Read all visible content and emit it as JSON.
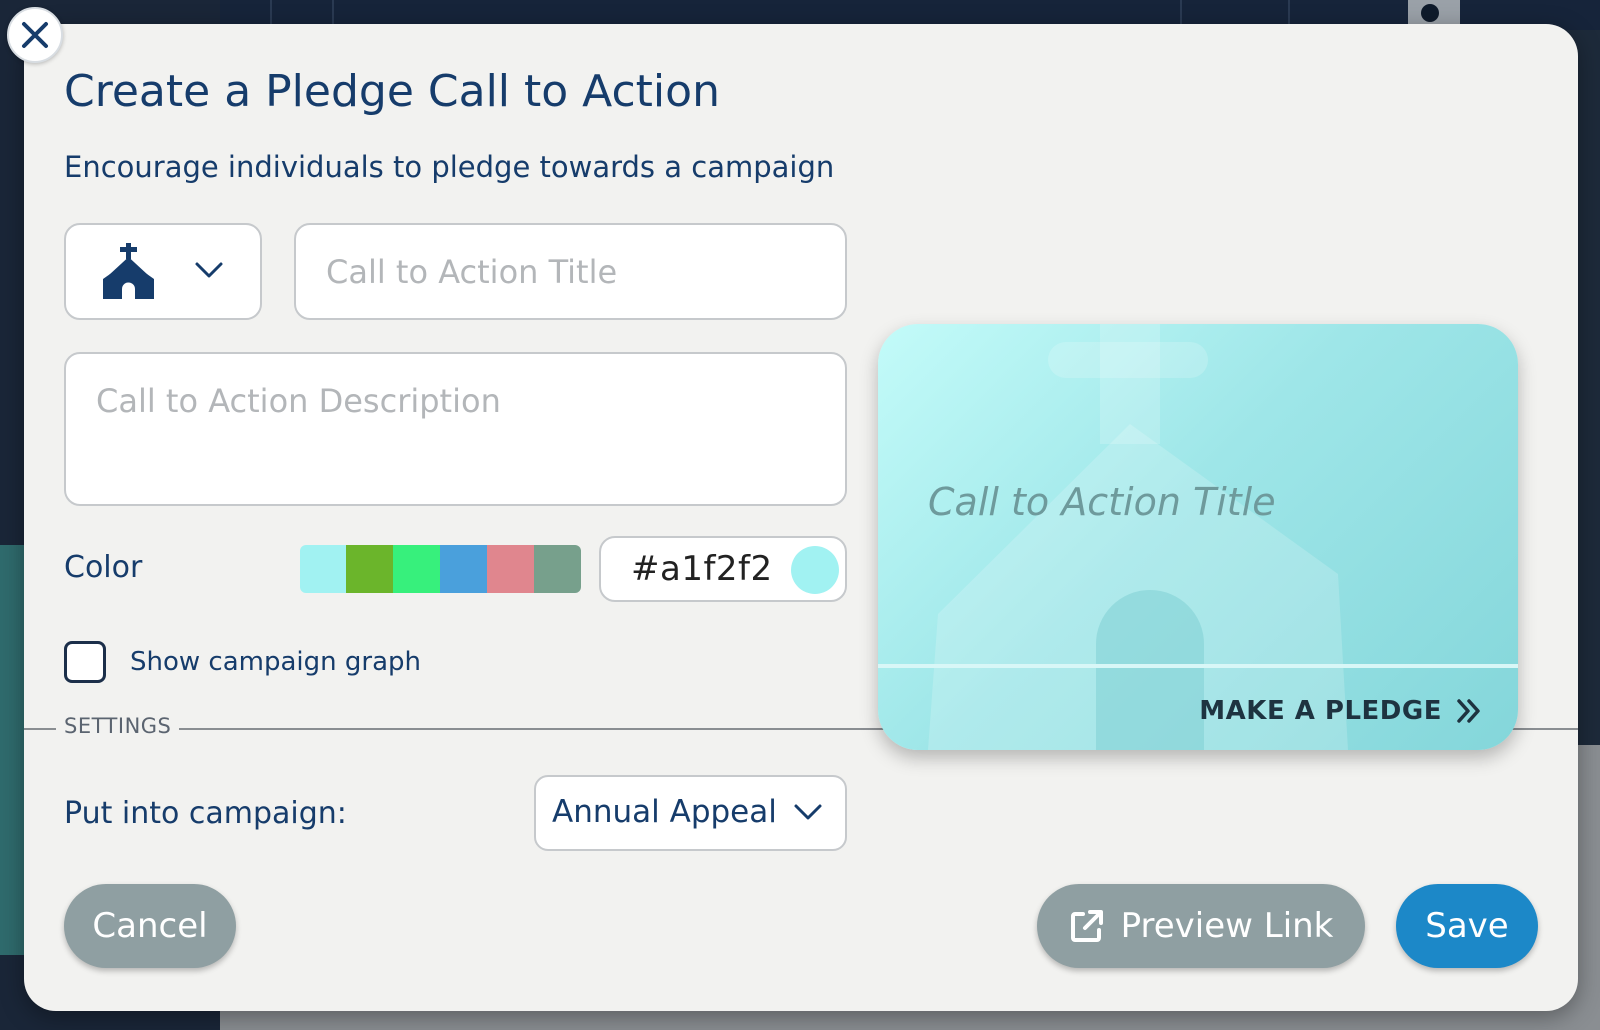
{
  "modal": {
    "title": "Create a Pledge Call to Action",
    "subtitle": "Encourage individuals to pledge towards a campaign"
  },
  "form": {
    "icon_select": {
      "selected_icon": "church-icon"
    },
    "title_placeholder": "Call to Action Title",
    "title_value": "",
    "description_placeholder": "Call to Action Description",
    "description_value": "",
    "color": {
      "label": "Color",
      "swatches": [
        "#a1f2f2",
        "#6bb52b",
        "#37f07c",
        "#4aa0dc",
        "#e0868e",
        "#77a08c"
      ],
      "hex_value": "#a1f2f2"
    },
    "show_graph": {
      "label": "Show campaign graph",
      "checked": false
    },
    "settings_label": "SETTINGS",
    "campaign": {
      "label": "Put into campaign:",
      "selected": "Annual Appeal"
    }
  },
  "buttons": {
    "cancel": "Cancel",
    "preview": "Preview Link",
    "save": "Save"
  },
  "preview_card": {
    "title": "Call to Action Title",
    "cta": "MAKE A PLEDGE"
  },
  "colors": {
    "primary_text": "#163c6b",
    "save_button": "#1c88c8",
    "secondary_button": "#8f9fa2",
    "modal_background": "#f2f2f0"
  }
}
